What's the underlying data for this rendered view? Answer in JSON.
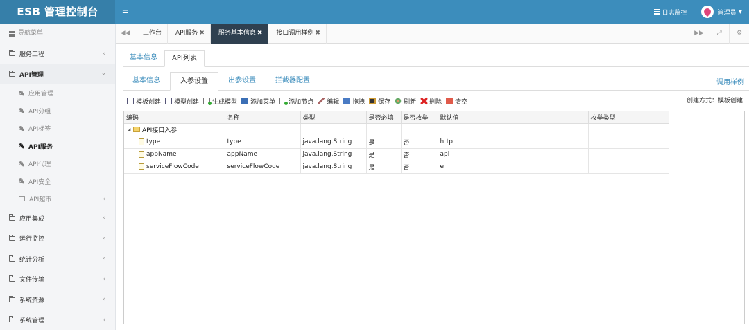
{
  "app": {
    "logo": "ESB 管理控制台",
    "menu_toggle_icon": "hamburger-icon",
    "log_monitor": "日志监控",
    "user": "管理员"
  },
  "sidebar": {
    "header": "导航菜单",
    "items": [
      {
        "label": "服务工程",
        "open": false
      },
      {
        "label": "API管理",
        "open": true
      },
      {
        "label": "应用集成",
        "open": false
      },
      {
        "label": "运行监控",
        "open": false
      },
      {
        "label": "统计分析",
        "open": false
      },
      {
        "label": "文件传输",
        "open": false
      },
      {
        "label": "系统资源",
        "open": false
      },
      {
        "label": "系统管理",
        "open": false
      }
    ],
    "api_sub": [
      {
        "label": "应用管理",
        "active": false
      },
      {
        "label": "API分组",
        "active": false
      },
      {
        "label": "API标签",
        "active": false
      },
      {
        "label": "API服务",
        "active": true
      },
      {
        "label": "API代理",
        "active": false
      },
      {
        "label": "API安全",
        "active": false
      },
      {
        "label": "API超市",
        "active": false
      }
    ]
  },
  "tabs": {
    "items": [
      {
        "label": "工作台",
        "closable": false
      },
      {
        "label": "API服务",
        "closable": true
      },
      {
        "label": "服务基本信息",
        "closable": true
      },
      {
        "label": "接口调用样例",
        "closable": true
      }
    ],
    "active_index": 2,
    "close_glyph": "✖"
  },
  "page_tabs": {
    "items": [
      "基本信息",
      "API列表"
    ],
    "active_index": 1
  },
  "api_tabs": {
    "items": [
      "基本信息",
      "入参设置",
      "出参设置",
      "拦截器配置"
    ],
    "active_index": 1,
    "example_link": "调用样例"
  },
  "toolbar": {
    "buttons": [
      {
        "label": "模板创建",
        "icon": "template-icon"
      },
      {
        "label": "模型创建",
        "icon": "model-icon"
      },
      {
        "label": "生成模型",
        "icon": "generate-icon"
      },
      {
        "label": "添加菜单",
        "icon": "menu-add-icon"
      },
      {
        "label": "添加节点",
        "icon": "node-add-icon"
      },
      {
        "label": "编辑",
        "icon": "edit-icon"
      },
      {
        "label": "拖拽",
        "icon": "drag-icon"
      },
      {
        "label": "保存",
        "icon": "save-icon"
      },
      {
        "label": "刷新",
        "icon": "refresh-icon"
      },
      {
        "label": "删除",
        "icon": "delete-icon"
      },
      {
        "label": "清空",
        "icon": "clear-icon"
      }
    ],
    "create_mode": "创建方式：模板创建"
  },
  "grid": {
    "columns": [
      "编码",
      "名称",
      "类型",
      "是否必填",
      "是否枚举",
      "默认值",
      "枚举类型"
    ],
    "root": "API接口入参",
    "rows": [
      {
        "code": "type",
        "name": "type",
        "type": "java.lang.String",
        "required": "是",
        "enum": "否",
        "default": "http",
        "enum_type": ""
      },
      {
        "code": "appName",
        "name": "appName",
        "type": "java.lang.String",
        "required": "是",
        "enum": "否",
        "default": "api",
        "enum_type": ""
      },
      {
        "code": "serviceFlowCode",
        "name": "serviceFlowCode",
        "type": "java.lang.String",
        "required": "是",
        "enum": "否",
        "default": "e",
        "enum_type": ""
      }
    ]
  }
}
